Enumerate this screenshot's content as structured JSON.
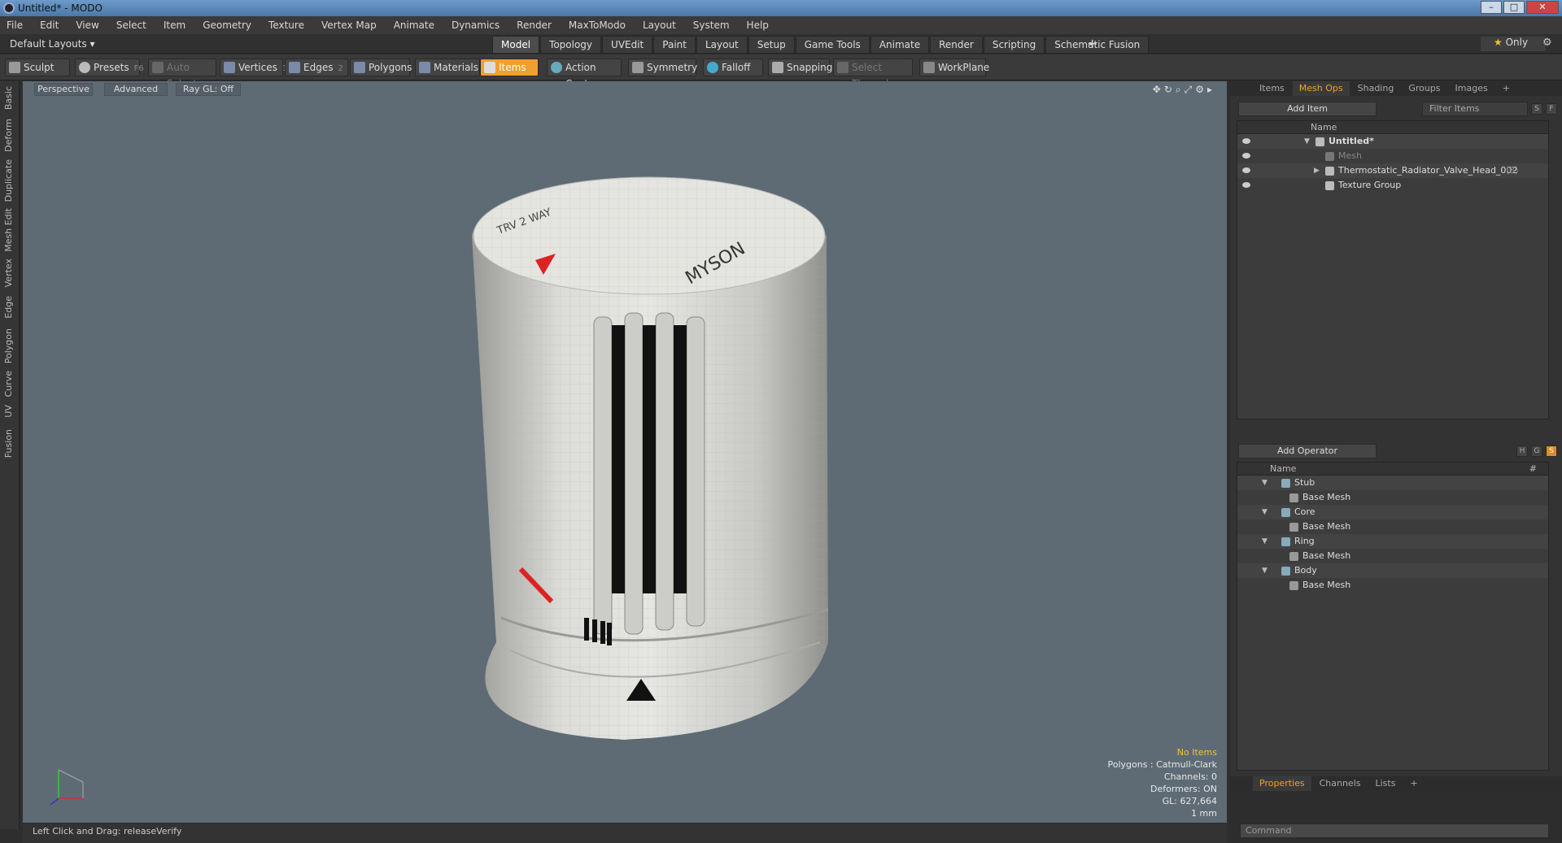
{
  "window": {
    "title": "Untitled* - MODO"
  },
  "menu": [
    "File",
    "Edit",
    "View",
    "Select",
    "Item",
    "Geometry",
    "Texture",
    "Vertex Map",
    "Animate",
    "Dynamics",
    "Render",
    "MaxToModo",
    "Layout",
    "System",
    "Help"
  ],
  "layouts": {
    "current": "Default Layouts ▾",
    "tabs": [
      "Model",
      "Topology",
      "UVEdit",
      "Paint",
      "Layout",
      "Setup",
      "Game Tools",
      "Animate",
      "Render",
      "Scripting",
      "Schematic Fusion"
    ],
    "active": "Model",
    "only": "Only"
  },
  "toolbar": {
    "sculpt": "Sculpt",
    "presets": "Presets",
    "presets_key": "F6",
    "auto_select": "Auto Select",
    "vertices": "Vertices",
    "vertices_key": "1",
    "edges": "Edges",
    "edges_key": "2",
    "polygons": "Polygons",
    "materials": "Materials",
    "items": "Items",
    "action_center": "Action Center",
    "symmetry": "Symmetry",
    "falloff": "Falloff",
    "snapping": "Snapping",
    "select_through": "Select Through",
    "workplane": "WorkPlane"
  },
  "left_tabs": [
    "Basic",
    "Deform",
    "Duplicate",
    "Mesh Edit",
    "Vertex",
    "Edge",
    "Polygon",
    "Curve",
    "UV",
    "Fusion"
  ],
  "viewport": {
    "view": "Perspective",
    "shading": "Advanced",
    "raygl": "Ray GL: Off",
    "stats": {
      "items": "No Items",
      "polygons": "Polygons : Catmull-Clark",
      "channels": "Channels: 0",
      "deformers": "Deformers: ON",
      "gl": "GL: 627,664",
      "unit": "1 mm"
    },
    "model_text": {
      "brand": "MYSON",
      "arc": "TRV 2 WAY"
    }
  },
  "status": {
    "hint": "Left Click and Drag:  releaseVerify"
  },
  "right_panel": {
    "tabs": [
      "Items",
      "Mesh Ops",
      "Shading",
      "Groups",
      "Images"
    ],
    "active_tab": "Mesh Ops",
    "add_item": "Add Item",
    "filter": "Filter Items",
    "s": "S",
    "f": "F",
    "header_name": "Name",
    "items": [
      {
        "label": "Untitled*",
        "bold": true
      },
      {
        "label": "Mesh",
        "dim": true
      },
      {
        "label": "Thermostatic_Radiator_Valve_Head_002",
        "count": "(3)"
      },
      {
        "label": "Texture Group"
      }
    ],
    "add_operator": "Add Operator",
    "op_header": "Name",
    "op_hash": "#",
    "ops": [
      {
        "group": "Stub",
        "child": "Base Mesh"
      },
      {
        "group": "Core",
        "child": "Base Mesh"
      },
      {
        "group": "Ring",
        "child": "Base Mesh"
      },
      {
        "group": "Body",
        "child": "Base Mesh"
      }
    ],
    "bottom_tabs": [
      "Properties",
      "Channels",
      "Lists"
    ],
    "bottom_active": "Properties",
    "command_placeholder": "Command"
  }
}
